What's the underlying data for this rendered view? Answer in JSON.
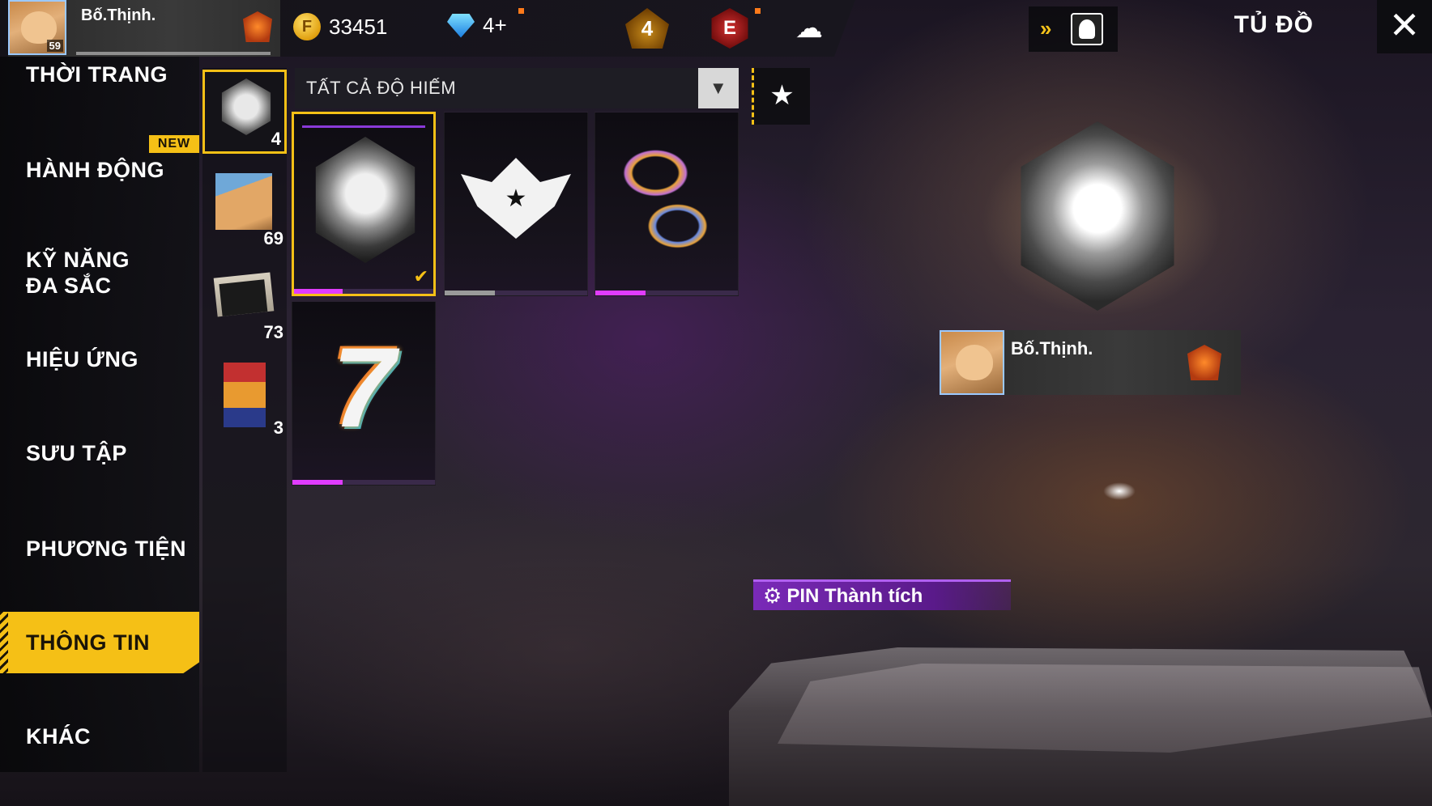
{
  "header": {
    "player_name": "Bố.Thịnh.",
    "player_level": "59",
    "gold": "33451",
    "diamonds": "4+",
    "crown_badge_value": "4",
    "e_badge_label": "E",
    "title": "TỦ ĐỒ",
    "close_symbol": "✕"
  },
  "categories": [
    {
      "label": "THỜI TRANG"
    },
    {
      "label": "HÀNH ĐỘNG"
    },
    {
      "label": "KỸ NĂNG ĐA SẮC"
    },
    {
      "label": "HIỆU ỨNG"
    },
    {
      "label": "SƯU TẬP"
    },
    {
      "label": "PHƯƠNG TIỆN"
    },
    {
      "label": "THÔNG TIN"
    },
    {
      "label": "KHÁC"
    }
  ],
  "active_category": "THÔNG TIN",
  "new_tag": "NEW",
  "subcategories": [
    {
      "icon": "trophy-icon",
      "count": "4"
    },
    {
      "icon": "cat-avatar-icon",
      "count": "69"
    },
    {
      "icon": "banner-card-icon",
      "count": "73"
    },
    {
      "icon": "anime-card-icon",
      "count": "3"
    }
  ],
  "filter": {
    "label": "TẤT CẢ ĐỘ HIẾM",
    "arrow": "▼"
  },
  "favorite_symbol": "★",
  "items": [
    {
      "name": "trophy-badge",
      "selected": true,
      "check": "✔"
    },
    {
      "name": "winged-star-badge",
      "selected": false,
      "wing_star": "★"
    },
    {
      "name": "ribbon-badge",
      "selected": false
    },
    {
      "name": "seven-badge",
      "selected": false,
      "glyph": "7"
    }
  ],
  "preview": {
    "player_name": "Bố.Thịnh.",
    "pin_label": "PIN Thành tích",
    "pin_icon": "⚙"
  },
  "colors": {
    "accent": "#f5c016",
    "epic": "#e03cff",
    "pin_bg": "#7a2ab8"
  }
}
